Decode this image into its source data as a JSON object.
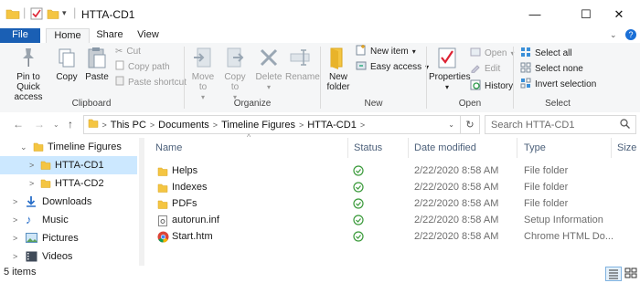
{
  "window": {
    "title": "HTTA-CD1",
    "controls": {
      "minimize": "—",
      "maximize": "☐",
      "close": "✕"
    }
  },
  "tabs": [
    {
      "label": "File"
    },
    {
      "label": "Home"
    },
    {
      "label": "Share"
    },
    {
      "label": "View"
    }
  ],
  "ribbon": {
    "clipboard": {
      "pin": "Pin to Quick access",
      "copy": "Copy",
      "paste": "Paste",
      "cut": "Cut",
      "copy_path": "Copy path",
      "paste_shortcut": "Paste shortcut",
      "label": "Clipboard"
    },
    "organize": {
      "move_to": "Move to",
      "copy_to": "Copy to",
      "delete": "Delete",
      "rename": "Rename",
      "label": "Organize"
    },
    "new": {
      "new_folder": "New folder",
      "new_item": "New item",
      "easy_access": "Easy access",
      "label": "New"
    },
    "open": {
      "properties": "Properties",
      "open": "Open",
      "edit": "Edit",
      "history": "History",
      "label": "Open"
    },
    "select": {
      "select_all": "Select all",
      "select_none": "Select none",
      "invert": "Invert selection",
      "label": "Select"
    }
  },
  "address": {
    "breadcrumbs": [
      "This PC",
      "Documents",
      "Timeline Figures",
      "HTTA-CD1"
    ],
    "search_placeholder": "Search HTTA-CD1"
  },
  "nav": [
    {
      "label": "Timeline Figures",
      "icon": "folder-icon"
    },
    {
      "label": "HTTA-CD1",
      "icon": "folder-icon",
      "selected": true
    },
    {
      "label": "HTTA-CD2",
      "icon": "folder-icon"
    },
    {
      "label": "Downloads",
      "icon": "download-icon"
    },
    {
      "label": "Music",
      "icon": "music-icon"
    },
    {
      "label": "Pictures",
      "icon": "pictures-icon"
    },
    {
      "label": "Videos",
      "icon": "videos-icon"
    }
  ],
  "columns": {
    "name": "Name",
    "status": "Status",
    "date": "Date modified",
    "type": "Type",
    "size": "Size"
  },
  "files": [
    {
      "name": "Helps",
      "date": "2/22/2020 8:58 AM",
      "type": "File folder",
      "icon": "folder-icon"
    },
    {
      "name": "Indexes",
      "date": "2/22/2020 8:58 AM",
      "type": "File folder",
      "icon": "folder-icon"
    },
    {
      "name": "PDFs",
      "date": "2/22/2020 8:58 AM",
      "type": "File folder",
      "icon": "folder-icon"
    },
    {
      "name": "autorun.inf",
      "date": "2/22/2020 8:58 AM",
      "type": "Setup Information",
      "icon": "settings-file-icon"
    },
    {
      "name": "Start.htm",
      "date": "2/22/2020 8:58 AM",
      "type": "Chrome HTML Do...",
      "icon": "chrome-icon"
    }
  ],
  "status_bar": {
    "item_count": "5 items"
  },
  "colors": {
    "accent": "#1a5fb4",
    "selection": "#cce8ff",
    "folder": "#f4c542",
    "synced": "#3a9a3a"
  }
}
